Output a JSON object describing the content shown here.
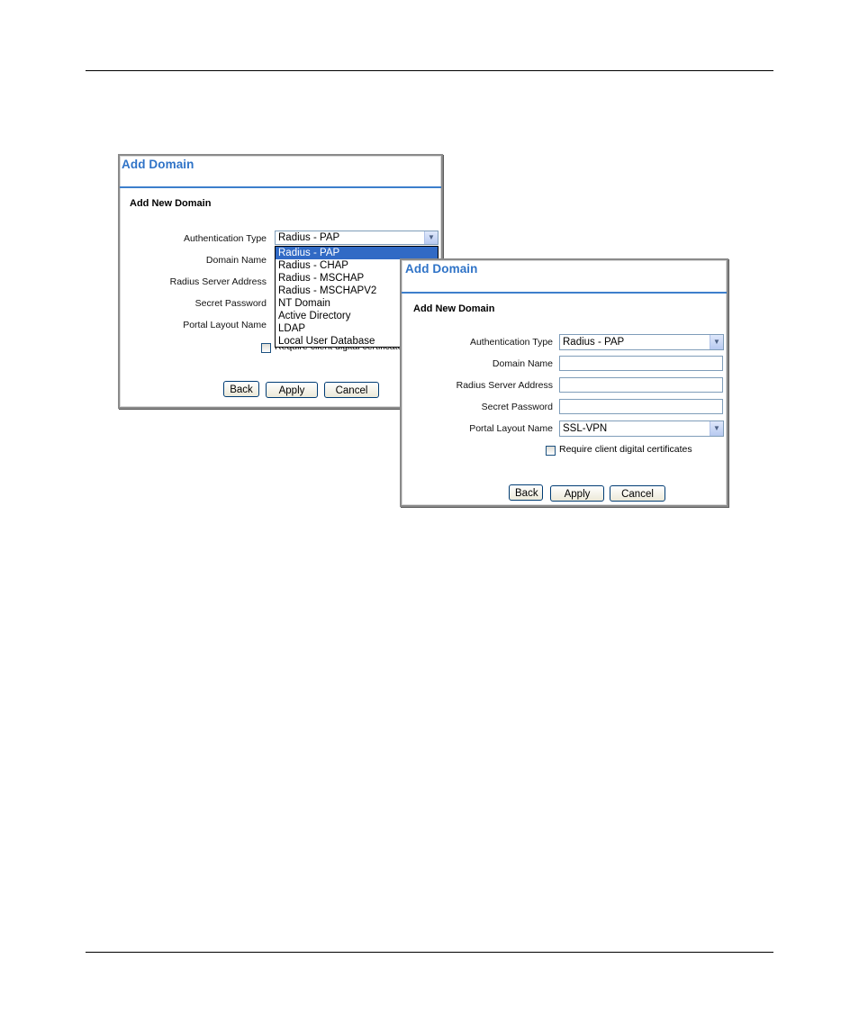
{
  "back_panel": {
    "title": "Add Domain",
    "subtitle": "Add New Domain",
    "labels": {
      "auth_type": "Authentication Type",
      "domain_name": "Domain Name",
      "radius_server": "Radius Server Address",
      "secret_password": "Secret Password",
      "portal_layout": "Portal Layout Name"
    },
    "auth_type_value": "Radius - PAP",
    "dropdown_options": [
      "Radius - PAP",
      "Radius - CHAP",
      "Radius - MSCHAP",
      "Radius - MSCHAPV2",
      "NT Domain",
      "Active Directory",
      "LDAP",
      "Local User Database"
    ],
    "checkbox_label": "Require client digital certificates",
    "buttons": {
      "back": "Back",
      "apply": "Apply",
      "cancel": "Cancel"
    }
  },
  "front_panel": {
    "title": "Add Domain",
    "subtitle": "Add New Domain",
    "labels": {
      "auth_type": "Authentication Type",
      "domain_name": "Domain Name",
      "radius_server": "Radius Server Address",
      "secret_password": "Secret Password",
      "portal_layout": "Portal Layout Name"
    },
    "auth_type_value": "Radius - PAP",
    "portal_layout_value": "SSL-VPN",
    "checkbox_label": "Require client digital certificates",
    "buttons": {
      "back": "Back",
      "apply": "Apply",
      "cancel": "Cancel"
    }
  },
  "colors": {
    "accent": "#2f73c7",
    "selection": "#316ac5",
    "rule": "#3d7fcc"
  }
}
